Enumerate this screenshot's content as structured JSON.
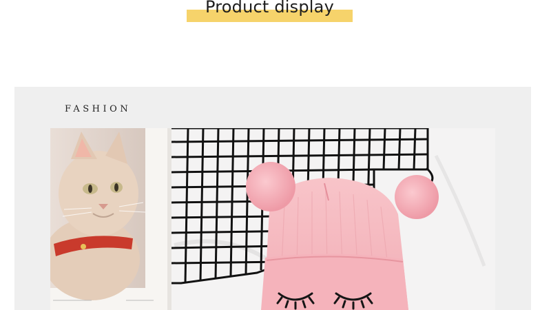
{
  "header": {
    "title": "Product display"
  },
  "panel": {
    "brand_text": "FASHION"
  },
  "colors": {
    "title_highlight": "#f6d36b",
    "panel_bg": "#efefef",
    "hat_pink": "#f6b8be",
    "pompom_pink": "#f5a9b4",
    "grid_black": "#111111",
    "cat_collar": "#c93a2c"
  },
  "photo": {
    "objects": [
      "book-page-with-cat-photo",
      "black-wire-grid-rack",
      "pink-knit-beanie-with-pompom-ears",
      "embroidered-closed-eyes"
    ]
  }
}
